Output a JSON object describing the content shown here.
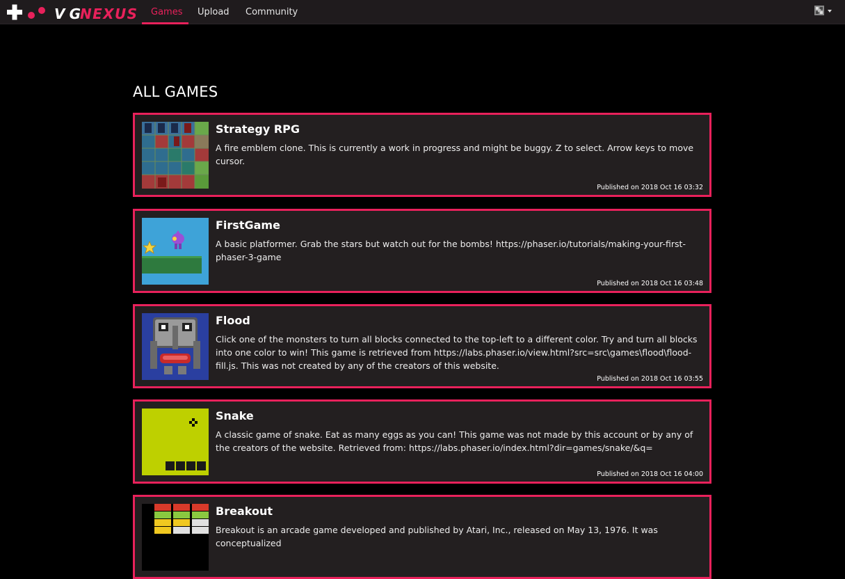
{
  "navbar": {
    "brand_text": "VGNEXUS",
    "links": [
      "Games",
      "Upload",
      "Community"
    ],
    "active_link": "Games",
    "accent_color": "#e8215b"
  },
  "page": {
    "title": "ALL GAMES"
  },
  "games": [
    {
      "title": "Strategy RPG",
      "description": "A fire emblem clone. This is currently a work in progress and might be buggy. Z to select. Arrow keys to move cursor.",
      "published": "Published on 2018 Oct 16 03:32",
      "thumbnail": "strategy-grid-thumbnail"
    },
    {
      "title": "FirstGame",
      "description": "A basic platformer. Grab the stars but watch out for the bombs! https://phaser.io/tutorials/making-your-first-phaser-3-game",
      "published": "Published on 2018 Oct 16 03:48",
      "thumbnail": "platformer-thumbnail"
    },
    {
      "title": "Flood",
      "description": "Click one of the monsters to turn all blocks connected to the top-left to a different color. Try and turn all blocks into one color to win! This game is retrieved from https://labs.phaser.io/view.html?src=src\\games\\flood\\flood-fill.js. This was not created by any of the creators of this website.",
      "published": "Published on 2018 Oct 16 03:55",
      "thumbnail": "monster-thumbnail"
    },
    {
      "title": "Snake",
      "description": "A classic game of snake. Eat as many eggs as you can! This game was not made by this account or by any of the creators of the website. Retrieved from: https://labs.phaser.io/index.html?dir=games/snake/&q=",
      "published": "Published on 2018 Oct 16 04:00",
      "thumbnail": "snake-thumbnail"
    },
    {
      "title": "Breakout",
      "description": "Breakout is an arcade game developed and published by Atari, Inc., released on May 13, 1976. It was conceptualized",
      "published": "",
      "thumbnail": "breakout-thumbnail"
    }
  ]
}
